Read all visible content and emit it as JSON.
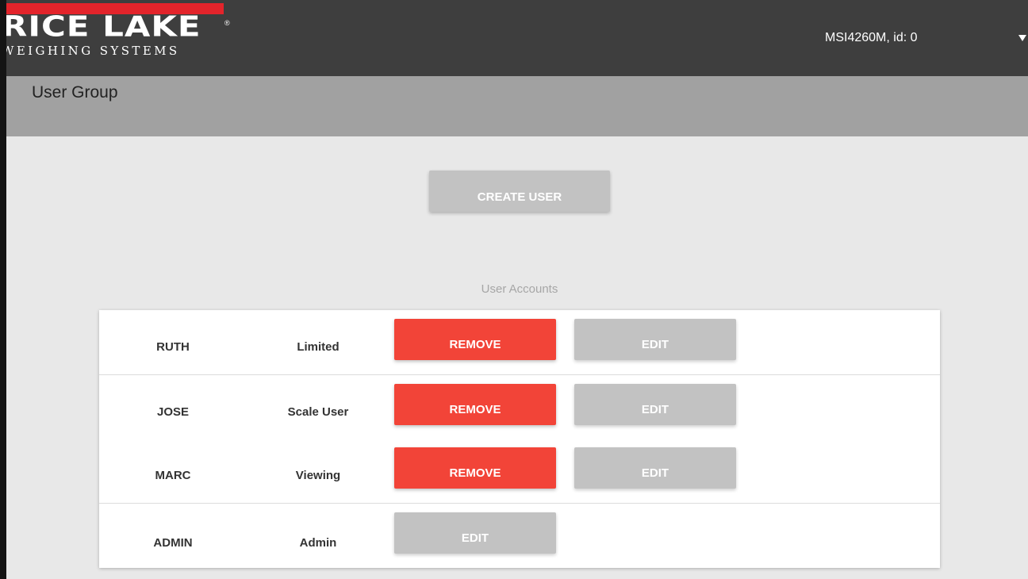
{
  "header": {
    "logo": {
      "main_text": "RICE LAKE",
      "sub_text": "WEIGHING SYSTEMS",
      "registered_mark": "®"
    },
    "device_label": "MSI4260M, id: 0",
    "menu_icon": "caret-down-icon"
  },
  "page": {
    "title": "User Group"
  },
  "actions": {
    "create_user_label": "CREATE USER"
  },
  "accounts": {
    "section_label": "User Accounts",
    "rows": [
      {
        "name": "RUTH",
        "role": "Limited",
        "remove_label": "REMOVE",
        "edit_label": "EDIT"
      },
      {
        "name": "JOSE",
        "role": "Scale User",
        "remove_label": "REMOVE",
        "edit_label": "EDIT"
      },
      {
        "name": "MARC",
        "role": "Viewing",
        "remove_label": "REMOVE",
        "edit_label": "EDIT"
      },
      {
        "name": "ADMIN",
        "role": "Admin",
        "edit_label": "EDIT"
      }
    ]
  },
  "colors": {
    "header_bg": "#3e3e3e",
    "logo_red": "#e3242b",
    "title_bar_bg": "#a1a1a1",
    "page_bg": "#e8e8e8",
    "remove_button": "#f24438",
    "neutral_button": "#c2c2c2"
  }
}
